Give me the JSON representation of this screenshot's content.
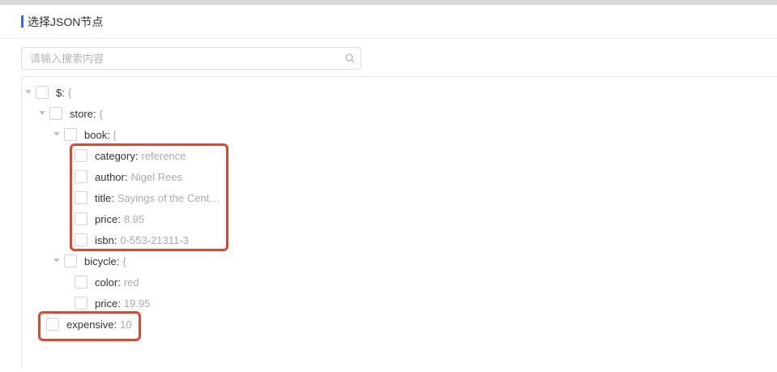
{
  "dialog": {
    "title": "选择JSON节点",
    "accent_color": "#2f6bea"
  },
  "search": {
    "placeholder": "请输入搜索内容",
    "value": ""
  },
  "tree": {
    "root": {
      "key": "$",
      "value": "{"
    },
    "store": {
      "key": "store",
      "value": "{"
    },
    "book": {
      "key": "book",
      "value": "["
    },
    "book_fields": [
      {
        "key": "category",
        "value": "reference"
      },
      {
        "key": "author",
        "value": "Nigel Rees"
      },
      {
        "key": "title",
        "value": "Sayings of the Centu..."
      },
      {
        "key": "price",
        "value": "8.95"
      },
      {
        "key": "isbn",
        "value": "0-553-21311-3"
      }
    ],
    "bicycle": {
      "key": "bicycle",
      "value": "{"
    },
    "bicycle_fields": [
      {
        "key": "color",
        "value": "red"
      },
      {
        "key": "price",
        "value": "19.95"
      }
    ],
    "expensive": {
      "key": "expensive",
      "value": "10"
    },
    "colon": ":"
  },
  "highlight_color": "#e0472f"
}
